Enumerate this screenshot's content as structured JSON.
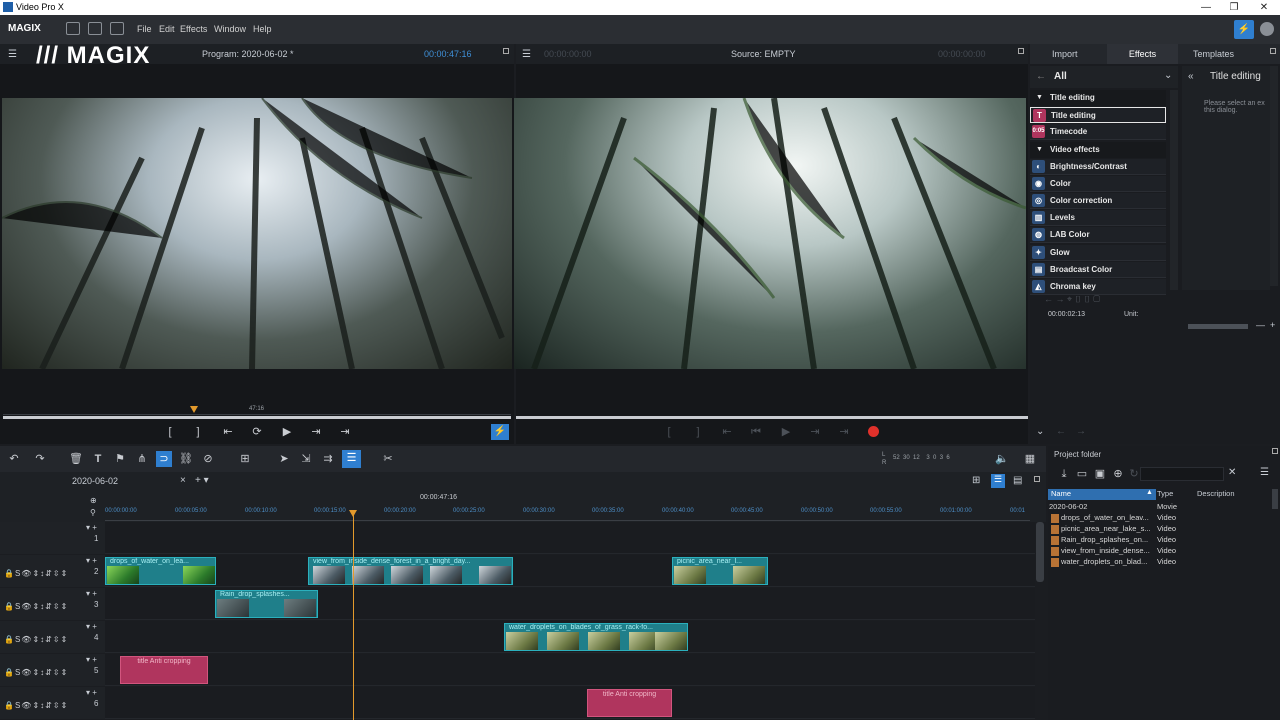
{
  "window": {
    "title": "Video Pro X"
  },
  "menu": {
    "brand": "MAGIX",
    "items": [
      "File",
      "Edit",
      "Effects",
      "Window",
      "Help"
    ]
  },
  "program_monitor": {
    "title": "Program: 2020-06-02 *",
    "timecode": "00:00:47:16",
    "watermark": "MAGIX",
    "scrub_label": "47:16"
  },
  "source_monitor": {
    "title": "Source: EMPTY",
    "timecode_left": "00:00:00:00",
    "timecode_right": "00:00:00:00"
  },
  "right_tabs": [
    "Import",
    "Effects",
    "Templates"
  ],
  "effects": {
    "filter": "All",
    "groups": [
      {
        "label": "Title editing",
        "items": [
          {
            "label": "Title editing",
            "icon": "T"
          },
          {
            "label": "Timecode",
            "icon": "0:05"
          }
        ]
      },
      {
        "label": "Video effects",
        "items": [
          {
            "label": "Brightness/Contrast",
            "icon": "◐"
          },
          {
            "label": "Color",
            "icon": "◉"
          },
          {
            "label": "Color correction",
            "icon": "◎"
          },
          {
            "label": "Levels",
            "icon": "▥"
          },
          {
            "label": "LAB Color",
            "icon": "◍"
          },
          {
            "label": "Glow",
            "icon": "✦"
          },
          {
            "label": "Broadcast Color",
            "icon": "▤"
          },
          {
            "label": "Chroma key",
            "icon": "◭"
          }
        ]
      }
    ],
    "detail_title": "Title editing",
    "detail_text": "Please select an ex this dialog.",
    "timecode": "00:00:02:13",
    "unit_label": "Unit:"
  },
  "timeline": {
    "tab": "2020-06-02",
    "cursor_tc": "00:00:47:16",
    "meter_labels": {
      "l": "L",
      "r": "R",
      "scale": "52  30  12    3  0  3  6"
    },
    "ruler": [
      "00:00:00:00",
      "00:00:05:00",
      "00:00:10:00",
      "00:00:15:00",
      "00:00:20:00",
      "00:00:25:00",
      "00:00:30:00",
      "00:00:35:00",
      "00:00:40:00",
      "00:00:45:00",
      "00:00:50:00",
      "00:00:55:00",
      "00:01:00:00",
      "00:01"
    ],
    "track_numbers": [
      "1",
      "2",
      "3",
      "4",
      "5",
      "6"
    ],
    "clips": {
      "c1": "drops_of_water_on_lea...",
      "c2": "view_from_inside_dense_forest_in_a_bright_day...",
      "c3": "picnic_area_near_l...",
      "c4": "Rain_drop_splashes...",
      "c5": "water_droplets_on_blades_of_grass_rack-fo...",
      "t1": "title  Anti cropping",
      "t2": "title  Anti cropping"
    }
  },
  "project_folder": {
    "title": "Project folder",
    "columns": [
      "Name",
      "Type",
      "Description"
    ],
    "rows": [
      {
        "name": "2020-06-02",
        "type": "Movie"
      },
      {
        "name": "drops_of_water_on_leav...",
        "type": "Video"
      },
      {
        "name": "picnic_area_near_lake_s...",
        "type": "Video"
      },
      {
        "name": "Rain_drop_splashes_on...",
        "type": "Video"
      },
      {
        "name": "view_from_inside_dense...",
        "type": "Video"
      },
      {
        "name": "water_droplets_on_blad...",
        "type": "Video"
      }
    ]
  },
  "colors": {
    "accent": "#3f8fd6",
    "clip": "#1f7f8a",
    "title_clip": "#b0355e",
    "record": "#e0312b",
    "playhead": "#e39a2c"
  }
}
